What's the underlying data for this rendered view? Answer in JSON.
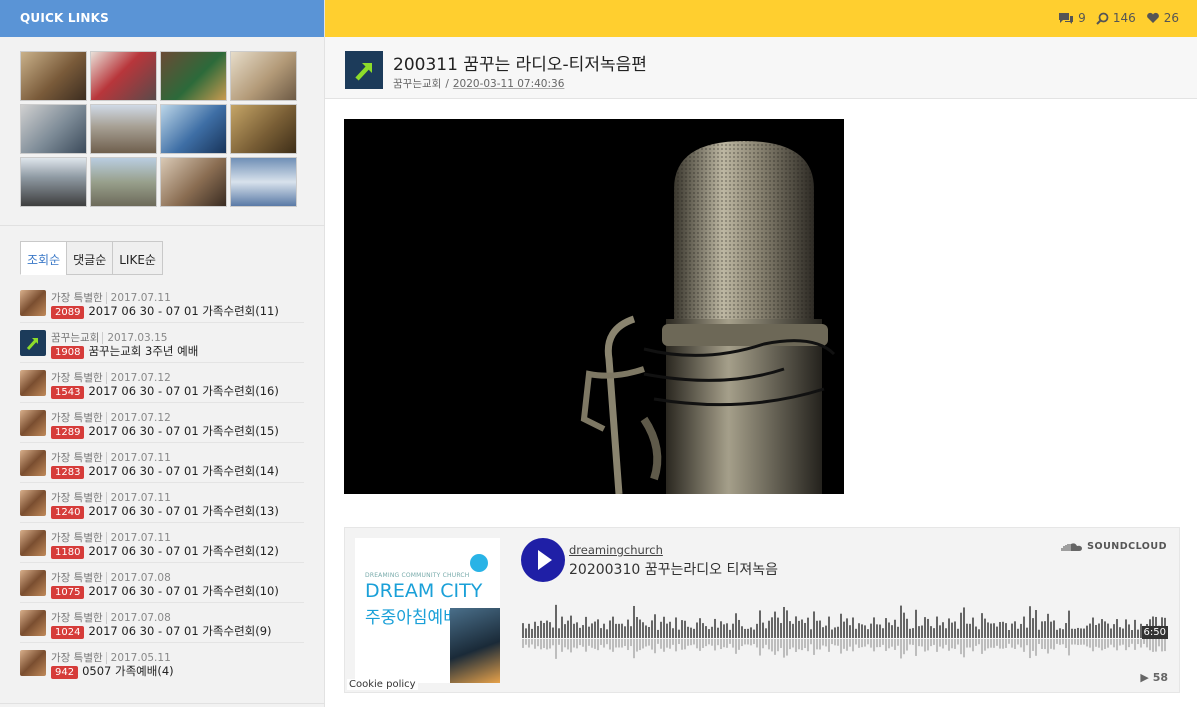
{
  "sidebar": {
    "title": "QUICK LINKS",
    "tabs": [
      "조회순",
      "댓글순",
      "LIKE순"
    ],
    "items": [
      {
        "author": "가장 특별한",
        "date": "2017.07.11",
        "count": "2089",
        "title": "2017 06 30 - 07 01 가족수련회(11)"
      },
      {
        "author": "꿈꾸는교회",
        "date": "2017.03.15",
        "count": "1908",
        "title": "꿈꾸는교회 3주년 예배"
      },
      {
        "author": "가장 특별한",
        "date": "2017.07.12",
        "count": "1543",
        "title": "2017 06 30 - 07 01 가족수련회(16)"
      },
      {
        "author": "가장 특별한",
        "date": "2017.07.12",
        "count": "1289",
        "title": "2017 06 30 - 07 01 가족수련회(15)"
      },
      {
        "author": "가장 특별한",
        "date": "2017.07.11",
        "count": "1283",
        "title": "2017 06 30 - 07 01 가족수련회(14)"
      },
      {
        "author": "가장 특별한",
        "date": "2017.07.11",
        "count": "1240",
        "title": "2017 06 30 - 07 01 가족수련회(13)"
      },
      {
        "author": "가장 특별한",
        "date": "2017.07.11",
        "count": "1180",
        "title": "2017 06 30 - 07 01 가족수련회(12)"
      },
      {
        "author": "가장 특별한",
        "date": "2017.07.08",
        "count": "1075",
        "title": "2017 06 30 - 07 01 가족수련회(10)"
      },
      {
        "author": "가장 특별한",
        "date": "2017.07.08",
        "count": "1024",
        "title": "2017 06 30 - 07 01 가족수련회(9)"
      },
      {
        "author": "가장 특별한",
        "date": "2017.05.11",
        "count": "942",
        "title": "0507 가족예배(4)"
      }
    ]
  },
  "topbar": {
    "comments": "9",
    "views": "146",
    "likes": "26"
  },
  "post": {
    "title": "200311 꿈꾸는 라디오-티저녹음편",
    "author": "꿈꾸는교회",
    "separator": "/",
    "datetime": "2020-03-11 07:40:36"
  },
  "soundcloud": {
    "user": "dreamingchurch",
    "track": "20200310 꿈꾸는라디오 티져녹음",
    "brand": "SOUNDCLOUD",
    "duration": "6:50",
    "plays": "58",
    "cookie": "Cookie policy",
    "art_small": "DREAMING COMMUNITY CHURCH",
    "art_title": "DREAM CITY",
    "art_subtitle": "주중아침예배"
  }
}
